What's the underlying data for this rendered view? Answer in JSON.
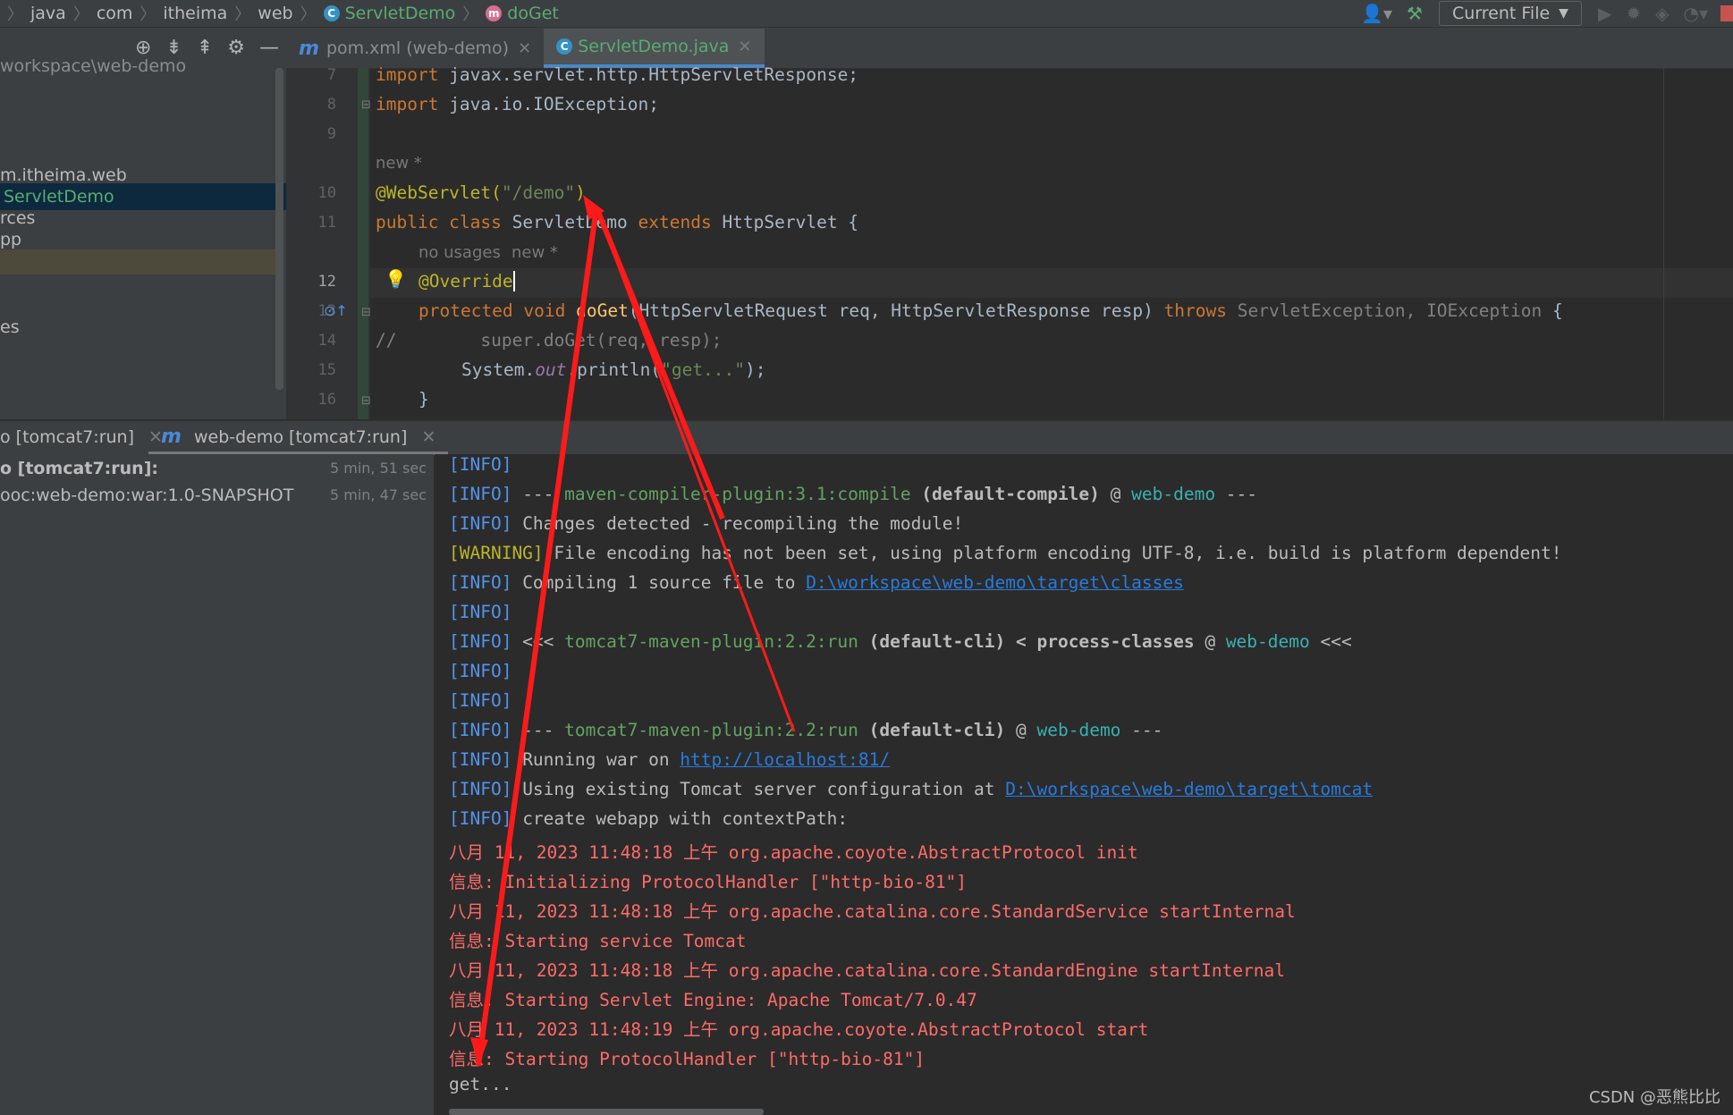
{
  "navbar": {
    "crumbs": [
      "java",
      "com",
      "itheima",
      "web",
      "ServletDemo",
      "doGet"
    ],
    "run_config": "Current File"
  },
  "project": {
    "path": "workspace\\web-demo",
    "items": [
      "m.itheima.web",
      "ServletDemo",
      "rces",
      "pp",
      "es"
    ]
  },
  "editor_tabs": [
    {
      "label": "pom.xml (web-demo)",
      "icon": "maven-icon"
    },
    {
      "label": "ServletDemo.java",
      "icon": "class-icon"
    }
  ],
  "code": {
    "line_numbers": [
      "7",
      "8",
      "9",
      "10",
      "11",
      "12",
      "13",
      "14",
      "15",
      "16"
    ],
    "hint_new": "new *",
    "hint_usages": "no usages",
    "hint_new2": "new *",
    "l7": {
      "kw": "import ",
      "rest": "javax.servlet.http.HttpServletResponse;"
    },
    "l8": {
      "kw": "import ",
      "rest": "java.io.IOException;"
    },
    "l10": {
      "ann": "@WebServlet(",
      "str": "\"/demo\"",
      "end": ")"
    },
    "l11": {
      "kw": "public class ",
      "name": "ServletDemo ",
      "kw2": "extends ",
      "rest": "HttpServlet {"
    },
    "l12": {
      "ann": "@Override"
    },
    "l13": {
      "kw": "protected void ",
      "fn": "doGet",
      "p1": "(HttpServletRequest req, HttpServletResponse resp) ",
      "kw2": "throws ",
      "ex": "ServletException, IOException",
      "end": " {"
    },
    "l14": {
      "cm": "//        super.doGet(req, resp);"
    },
    "l15": {
      "a": "System.",
      "out": "out",
      "b": ".println(",
      "str": "\"get...\"",
      "end": ");"
    },
    "l16": {
      "text": "}"
    }
  },
  "toolwindow": {
    "tab1": "o [tomcat7:run]",
    "tab2": "web-demo [tomcat7:run]",
    "tree": [
      {
        "label": "o [tomcat7:run]:",
        "time": "5 min, 51 sec"
      },
      {
        "label": "ooc:web-demo:war:1.0-SNAPSHOT",
        "time": "5 min, 47 sec"
      }
    ]
  },
  "console": {
    "info": "[INFO]",
    "warning": "[WARNING]",
    "l2": {
      "a": " --- ",
      "plg": "maven-compiler-plugin:3.1:compile",
      "b": " (default-compile)",
      "c": " @ ",
      "prj": "web-demo",
      "d": " ---"
    },
    "l3": " Changes detected - recompiling the module!",
    "l4": " File encoding has not been set, using platform encoding UTF-8, i.e. build is platform dependent!",
    "l5": {
      "a": " Compiling 1 source file to ",
      "link": "D:\\workspace\\web-demo\\target\\classes"
    },
    "l7": {
      "a": " <<< ",
      "plg": "tomcat7-maven-plugin:2.2:run",
      "b": " (default-cli) < process-classes",
      "c": " @ ",
      "prj": "web-demo",
      "d": " <<<"
    },
    "l10": {
      "a": " --- ",
      "plg": "tomcat7-maven-plugin:2.2:run",
      "b": " (default-cli)",
      "c": " @ ",
      "prj": "web-demo",
      "d": " ---"
    },
    "l11": {
      "a": " Running war on ",
      "link": "http://localhost:81/"
    },
    "l12": {
      "a": " Using existing Tomcat server configuration at ",
      "link": "D:\\workspace\\web-demo\\target\\tomcat"
    },
    "l13": " create webapp with contextPath:",
    "red": [
      "八月 11, 2023 11:48:18 上午 org.apache.coyote.AbstractProtocol init",
      "信息: Initializing ProtocolHandler [\"http-bio-81\"]",
      "八月 11, 2023 11:48:18 上午 org.apache.catalina.core.StandardService startInternal",
      "信息: Starting service Tomcat",
      "八月 11, 2023 11:48:18 上午 org.apache.catalina.core.StandardEngine startInternal",
      "信息: Starting Servlet Engine: Apache Tomcat/7.0.47",
      "八月 11, 2023 11:48:19 上午 org.apache.coyote.AbstractProtocol start",
      "信息: Starting ProtocolHandler [\"http-bio-81\"]"
    ],
    "last": "get..."
  },
  "watermark": "CSDN @恶熊比比",
  "colors": {
    "arrow": "#ff1a1a",
    "accent": "#4a88c7"
  }
}
